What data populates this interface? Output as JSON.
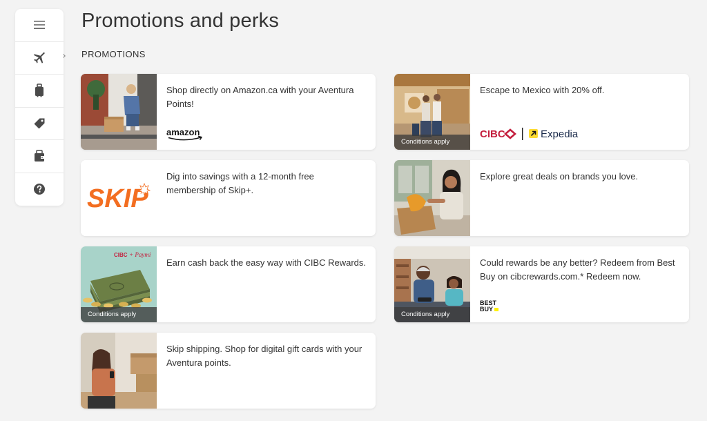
{
  "page": {
    "title": "Promotions and perks",
    "section_label": "PROMOTIONS"
  },
  "sidebar": {
    "items": [
      {
        "icon": "menu-icon"
      },
      {
        "icon": "airplane-icon"
      },
      {
        "icon": "luggage-icon"
      },
      {
        "icon": "tag-icon"
      },
      {
        "icon": "wallet-icon"
      },
      {
        "icon": "help-icon"
      }
    ]
  },
  "colors": {
    "cibc_red": "#c41f3e",
    "skip_orange": "#f36e21",
    "expedia_yellow": "#fddb32",
    "bestbuy_yellow": "#fff200"
  },
  "promotions": [
    {
      "text": "Shop directly on Amazon.ca with your Aventura Points!",
      "logo": "amazon",
      "logo_text": "amazon",
      "conditions": ""
    },
    {
      "text": "Escape to Mexico with 20% off.",
      "logo": "cibc-expedia",
      "logo_text_1": "CIBC",
      "logo_text_2": "Expedia",
      "conditions": "Conditions apply"
    },
    {
      "text": "Dig into savings with a 12-month free membership of Skip+.",
      "logo": "skip",
      "logo_text": "SKIP",
      "conditions": ""
    },
    {
      "text": "Explore great deals on brands you love.",
      "logo": "",
      "conditions": ""
    },
    {
      "text": "Earn cash back the easy way with CIBC Rewards.",
      "logo": "cibc-paymi",
      "logo_text_1": "CIBC",
      "logo_text_2": "+ Paymi",
      "conditions": "Conditions apply"
    },
    {
      "text": "Could rewards be any better? Redeem from Best Buy on cibcrewards.com.* Redeem now.",
      "logo": "bestbuy",
      "logo_text_1": "BEST",
      "logo_text_2": "BUY",
      "conditions": "Conditions apply"
    },
    {
      "text": "Skip shipping. Shop for digital gift cards with your Aventura points.",
      "logo": "",
      "conditions": ""
    }
  ]
}
